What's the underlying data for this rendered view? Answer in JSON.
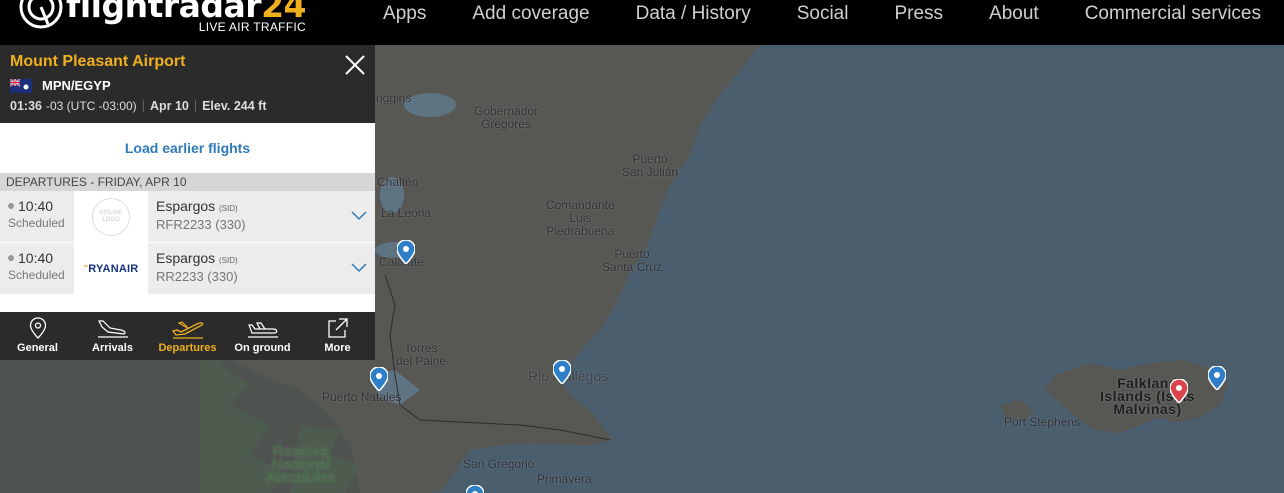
{
  "brand": {
    "name_part1": "flightradar",
    "name_part2": "24",
    "tagline": "LIVE AIR TRAFFIC",
    "accent": "#f0b01e"
  },
  "nav": {
    "items": [
      "Apps",
      "Add coverage",
      "Data / History",
      "Social",
      "Press",
      "About",
      "Commercial services"
    ]
  },
  "panel": {
    "airport_name": "Mount Pleasant Airport",
    "code": "MPN/EGYP",
    "local_time": "01:36",
    "timezone": "-03 (UTC -03:00)",
    "date": "Apr 10",
    "elevation": "Elev. 244 ft",
    "load_earlier": "Load earlier flights",
    "section_header": "DEPARTURES - FRIDAY, APR 10",
    "flights": [
      {
        "time": "10:40",
        "status": "Scheduled",
        "destination": "Espargos",
        "dest_code": "(SID)",
        "flight": "RFR2233 (330)",
        "airline_logo": "airline-logo-placeholder",
        "placeholder_text": "AIRLINE LOGO"
      },
      {
        "time": "10:40",
        "status": "Scheduled",
        "destination": "Espargos",
        "dest_code": "(SID)",
        "flight": "RR2233 (330)",
        "airline_logo": "ryanair-logo",
        "logo_text": "RYANAIR"
      }
    ],
    "tabs": [
      {
        "label": "General",
        "icon": "map-pin-icon"
      },
      {
        "label": "Arrivals",
        "icon": "arrival-plane-icon"
      },
      {
        "label": "Departures",
        "icon": "departure-plane-icon",
        "active": true
      },
      {
        "label": "On ground",
        "icon": "grounded-plane-icon"
      },
      {
        "label": "More",
        "icon": "external-link-icon"
      }
    ]
  },
  "map": {
    "labels": {
      "riggins": "riggins",
      "gobernador": "Gobernador\nGregores",
      "san_julian": "Puerto\nSan Julián",
      "chalten": "Chaltén",
      "comandante": "Comandante\nLuis\nPiedrabuena",
      "la_leona": "La Leona",
      "santa_cruz": "Puerto\nSanta Cruz",
      "calafate": "Calafate",
      "torres": "Torres\ndel Paine",
      "rio_gallegos": "Rio Gallegos",
      "puerto_natales": "Puerto Natales",
      "reserva": "Reserva\nNacional\nAlacalufes",
      "san_gregorio": "San Gregorio",
      "primavera": "Primavera",
      "falkland": "Falkland\nIslands (Islas\nMalvinas)",
      "port_stephens": "Port Stephens"
    },
    "colors": {
      "sea": "#4a5e6e",
      "land": "#575754",
      "pin_blue": "#2f7fc8",
      "pin_red": "#d9434a"
    }
  }
}
